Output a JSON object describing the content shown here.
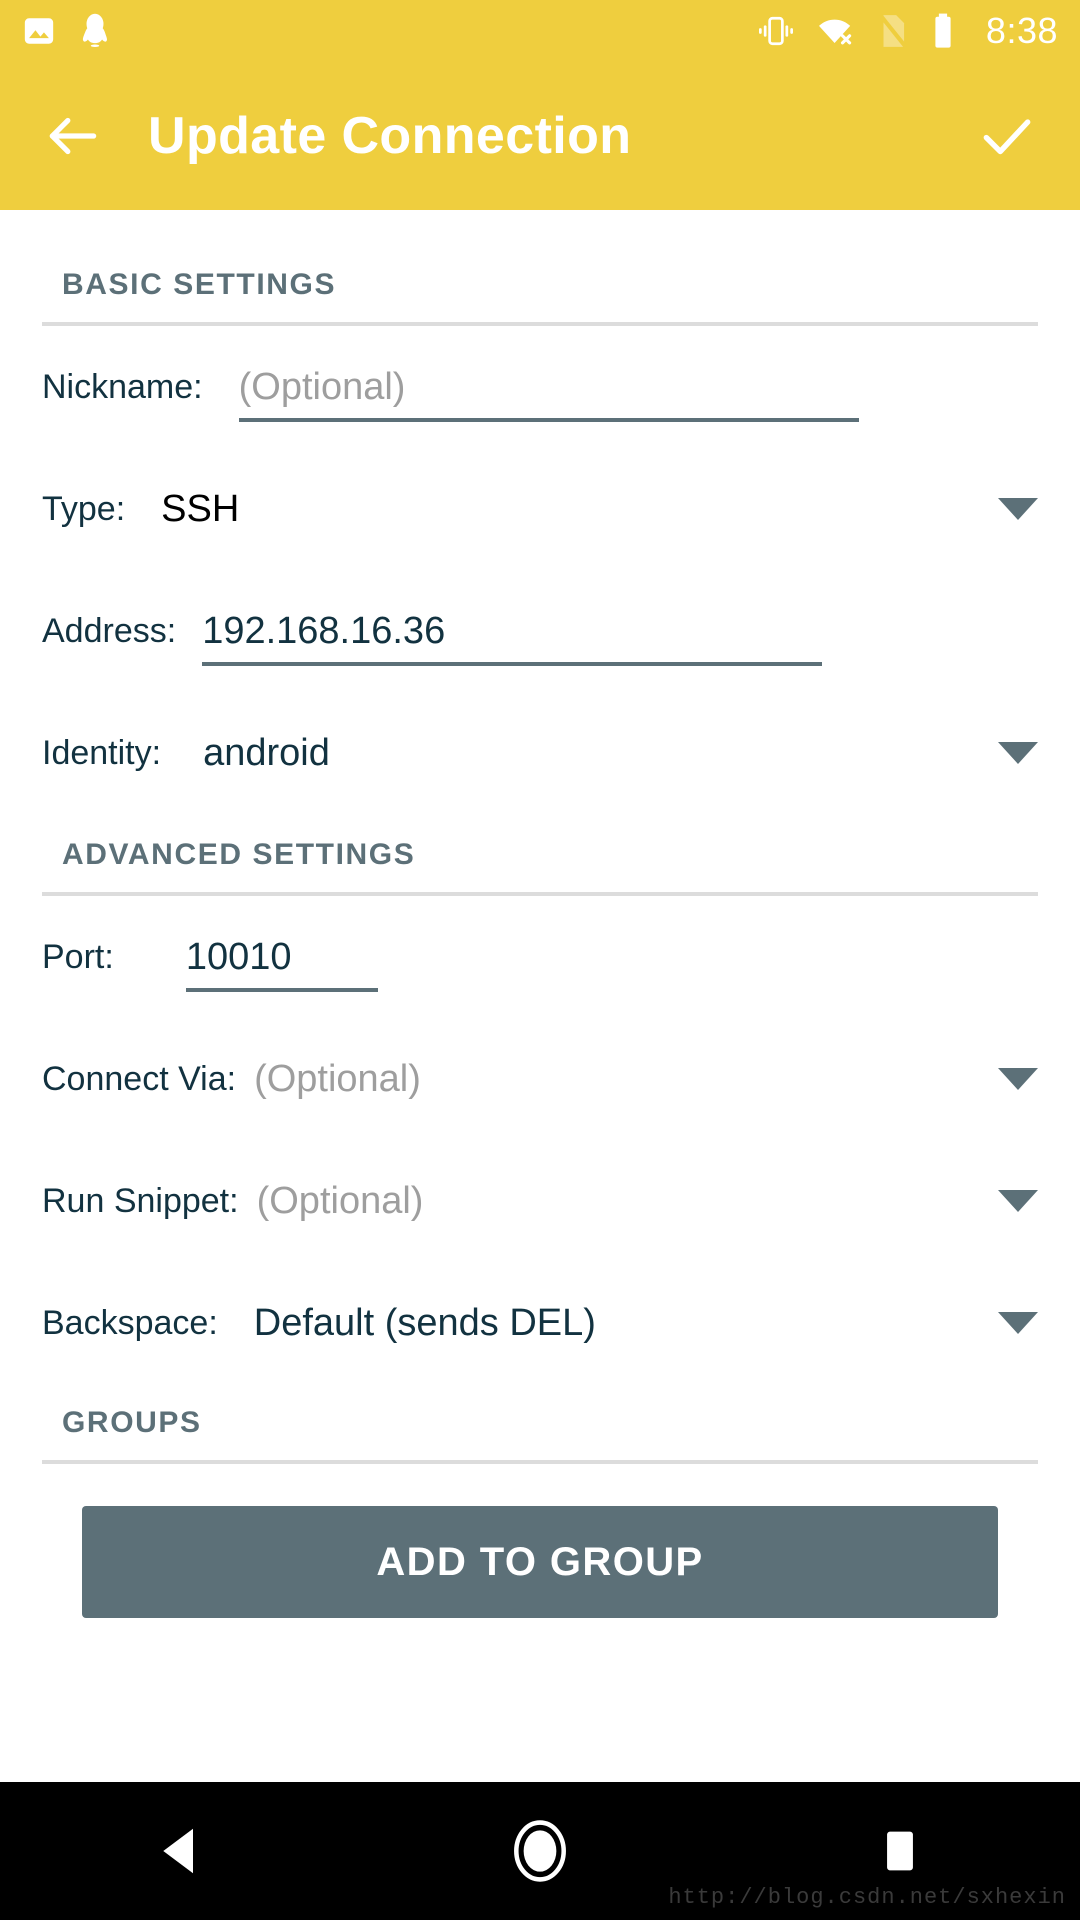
{
  "status_bar": {
    "time": "8:38",
    "icons_left": [
      "image-icon",
      "qq-penguin-icon"
    ],
    "icons_right": [
      "vibrate-icon",
      "wifi-no-internet-icon",
      "no-sim-icon",
      "battery-full-icon"
    ],
    "accent_color": "#EFCE3E"
  },
  "app_bar": {
    "title": "Update Connection",
    "back_icon": "back-arrow-icon",
    "confirm_icon": "check-icon",
    "background": "#EFCE3E",
    "text_color": "#FFFFFF"
  },
  "sections": {
    "basic": {
      "header": "BASIC SETTINGS",
      "fields": [
        {
          "label": "Nickname:",
          "value": "",
          "placeholder": "(Optional)",
          "type": "text",
          "has_caret": false,
          "underline": "full"
        },
        {
          "label": "Type:",
          "value": "SSH",
          "placeholder": "",
          "type": "select",
          "has_caret": true,
          "underline": "none"
        },
        {
          "label": "Address:",
          "value": "192.168.16.36",
          "placeholder": "",
          "type": "text",
          "has_caret": false,
          "underline": "full"
        },
        {
          "label": "Identity:",
          "value": "android",
          "placeholder": "",
          "type": "select",
          "has_caret": true,
          "underline": "none"
        }
      ]
    },
    "advanced": {
      "header": "ADVANCED SETTINGS",
      "fields": [
        {
          "label": "Port:",
          "value": "10010",
          "placeholder": "",
          "type": "text",
          "has_caret": false,
          "underline": "short"
        },
        {
          "label": "Connect Via:",
          "value": "",
          "placeholder": "(Optional)",
          "type": "select",
          "has_caret": true,
          "underline": "none"
        },
        {
          "label": "Run Snippet:",
          "value": "",
          "placeholder": "(Optional)",
          "type": "select",
          "has_caret": true,
          "underline": "none"
        },
        {
          "label": "Backspace:",
          "value": "Default (sends DEL)",
          "placeholder": "",
          "type": "select",
          "has_caret": true,
          "underline": "none"
        }
      ]
    },
    "groups": {
      "header": "GROUPS",
      "add_button_label": "ADD TO GROUP",
      "button_color": "#5C7078"
    }
  },
  "nav_bar": {
    "back": "back-triangle-icon",
    "home": "home-circle-icon",
    "recents": "recents-square-icon",
    "watermark": "http://blog.csdn.net/sxhexin"
  }
}
